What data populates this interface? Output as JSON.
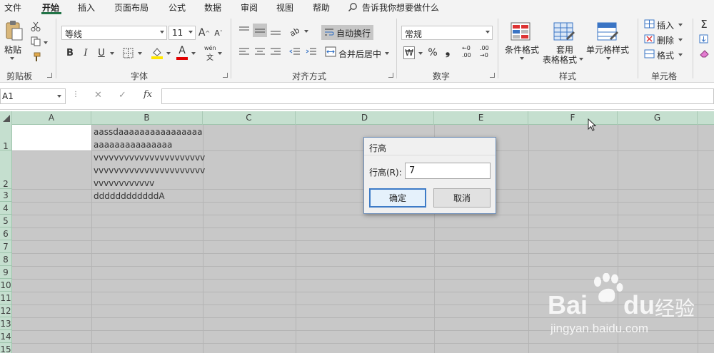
{
  "menu": {
    "items": [
      "文件",
      "开始",
      "插入",
      "页面布局",
      "公式",
      "数据",
      "审阅",
      "视图",
      "帮助"
    ],
    "active": "开始",
    "tell_me": "告诉我你想要做什么"
  },
  "ribbon": {
    "clipboard": {
      "paste_label": "粘贴",
      "group_label": "剪贴板"
    },
    "font": {
      "font_name": "等线",
      "font_size": "11",
      "bold": "B",
      "italic": "I",
      "underline": "U",
      "grow": "A",
      "shrink": "A",
      "font_color_glyph": "A",
      "phonetic_top": "wén",
      "phonetic_bottom": "文",
      "group_label": "字体"
    },
    "alignment": {
      "wrap_text": "自动换行",
      "merge_center": "合并后居中",
      "group_label": "对齐方式"
    },
    "number": {
      "format": "常规",
      "currency": "₩",
      "percent": "%",
      "comma": "❟",
      "inc_decimal_top": "←0",
      "inc_decimal_bottom": ".00",
      "dec_decimal_top": ".00",
      "dec_decimal_bottom": "→0",
      "group_label": "数字"
    },
    "styles": {
      "conditional": "条件格式",
      "table_line1": "套用",
      "table_line2": "表格格式",
      "cell_styles": "单元格样式",
      "group_label": "样式"
    },
    "cells": {
      "insert": "插入",
      "delete": "删除",
      "format": "格式",
      "group_label": "单元格"
    },
    "editing": {
      "sum": "Σ"
    }
  },
  "formula_bar": {
    "name_box": "A1",
    "cancel": "✕",
    "enter": "✓",
    "fx": "fx",
    "value": ""
  },
  "sheet": {
    "columns": [
      "A",
      "B",
      "C",
      "D",
      "E",
      "F",
      "G"
    ],
    "rows": [
      "1",
      "2",
      "3",
      "4",
      "5",
      "6",
      "7",
      "8",
      "9",
      "10",
      "11",
      "12",
      "13",
      "14",
      "15"
    ],
    "cells": {
      "B1_line1": "aassdaaaaaaaaaaaaaaaa",
      "B1_line2": "aaaaaaaaaaaaaaa",
      "B2_line1": "vvvvvvvvvvvvvvvvvvvvvv",
      "B2_line2": "vvvvvvvvvvvvvvvvvvvvvv",
      "B2_line3": "vvvvvvvvvvvv",
      "B3": "ddddddddddddA"
    }
  },
  "dialog": {
    "title": "行高",
    "label": "行高(R):",
    "value": "7",
    "ok": "确定",
    "cancel": "取消"
  },
  "watermark": {
    "brand": "Bai",
    "brand2": "du",
    "suffix": "经验",
    "url": "jingyan.baidu.com"
  },
  "colors": {
    "accent": "#217346",
    "header_selected": "#c5dfcf",
    "sheet_selected": "#c8c8c8",
    "dialog_focus": "#3d7bc7"
  }
}
